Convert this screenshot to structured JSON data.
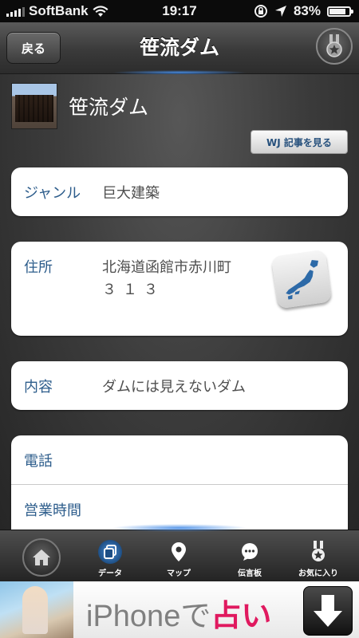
{
  "status_bar": {
    "carrier": "SoftBank",
    "time": "19:17",
    "battery": "83%",
    "battery_level": 0.83
  },
  "nav": {
    "back_label": "戻る",
    "title": "笹流ダム"
  },
  "place": {
    "name": "笹流ダム",
    "wj_button_label": "WJ 記事を見る"
  },
  "details": {
    "genre": {
      "label": "ジャンル",
      "value": "巨大建築"
    },
    "address": {
      "label": "住所",
      "line1": "北海道函館市赤川町",
      "line2": "３１３"
    },
    "content": {
      "label": "内容",
      "value": "ダムには見えないダム"
    },
    "phone": {
      "label": "電話",
      "value": ""
    },
    "hours": {
      "label": "営業時間",
      "value": ""
    }
  },
  "tabs": [
    {
      "label": "データ",
      "icon": "data-icon",
      "active": true
    },
    {
      "label": "マップ",
      "icon": "map-pin-icon",
      "active": false
    },
    {
      "label": "伝言板",
      "icon": "chat-bubble-icon",
      "active": false
    },
    {
      "label": "お気に入り",
      "icon": "medal-icon",
      "active": false
    }
  ],
  "ad": {
    "text_main": "iPhoneで",
    "text_highlight": "占い"
  },
  "colors": {
    "accent_blue": "#2c5c8b",
    "ad_pink": "#e0195f",
    "nav_glow": "#468ce6"
  }
}
